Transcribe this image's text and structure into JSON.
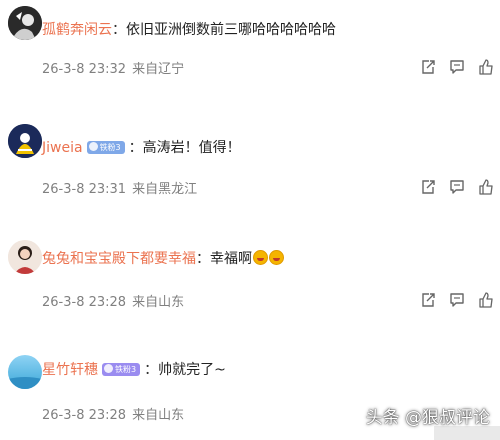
{
  "comments": [
    {
      "username": "孤鹤奔闲云",
      "separator": "：",
      "text": "依旧亚洲倒数前三哪哈哈哈哈哈哈",
      "timestamp": "26-3-8 23:32",
      "location": "来自辽宁",
      "badge": "",
      "emoji_count": 0
    },
    {
      "username": "Jiweia",
      "separator": "：",
      "text": "高涛岩！值得！",
      "timestamp": "26-3-8 23:31",
      "location": "来自黑龙江",
      "badge": "铁粉3",
      "emoji_count": 0
    },
    {
      "username": "兔兔和宝宝殿下都要幸福",
      "separator": "：",
      "text": "幸福啊",
      "timestamp": "26-3-8 23:28",
      "location": "来自山东",
      "badge": "",
      "emoji_count": 2
    },
    {
      "username": "星竹轩穗",
      "separator": "：",
      "text": "帅就完了~",
      "timestamp": "26-3-8 23:28",
      "location": "来自山东",
      "badge": "铁粉3",
      "emoji_count": 0
    }
  ],
  "watermark": "头条 @狠叔评论",
  "icons": [
    "share-icon",
    "comment-icon",
    "like-icon"
  ],
  "colors": {
    "username": "#eb7350",
    "meta": "#808080",
    "badge": "#9a8cf0"
  }
}
